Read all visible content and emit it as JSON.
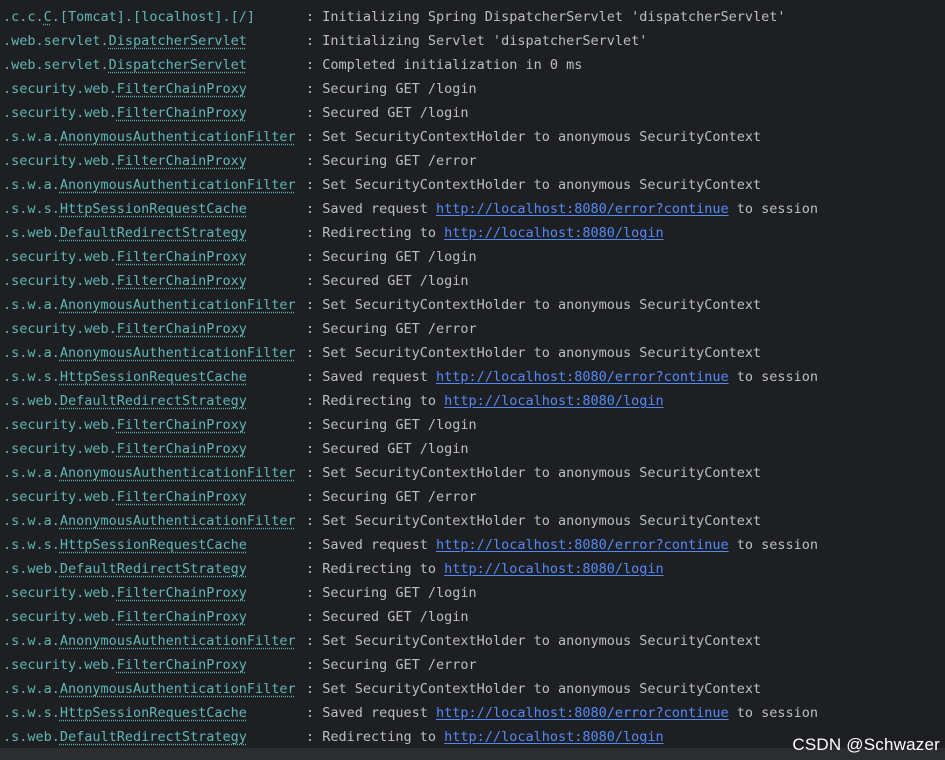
{
  "colors": {
    "background": "#1e1f22",
    "logger_text": "#5fb8b3",
    "message_text": "#bcbec4",
    "link": "#548af7",
    "watermark": "#ffffff"
  },
  "console": {
    "lines": [
      {
        "logger_prefix": ".c.c.",
        "logger_class": "C",
        "logger_suffix": ".[Tomcat].[localhost].[/]",
        "msg_before": ": Initializing Spring DispatcherServlet 'dispatcherServlet'",
        "link": "",
        "msg_after": ""
      },
      {
        "logger_prefix": ".web.servlet.",
        "logger_class": "DispatcherServlet",
        "logger_suffix": "",
        "msg_before": ": Initializing Servlet 'dispatcherServlet'",
        "link": "",
        "msg_after": ""
      },
      {
        "logger_prefix": ".web.servlet.",
        "logger_class": "DispatcherServlet",
        "logger_suffix": "",
        "msg_before": ": Completed initialization in 0 ms",
        "link": "",
        "msg_after": ""
      },
      {
        "logger_prefix": ".security.web.",
        "logger_class": "FilterChainProxy",
        "logger_suffix": "",
        "msg_before": ": Securing GET /login",
        "link": "",
        "msg_after": ""
      },
      {
        "logger_prefix": ".security.web.",
        "logger_class": "FilterChainProxy",
        "logger_suffix": "",
        "msg_before": ": Secured GET /login",
        "link": "",
        "msg_after": ""
      },
      {
        "logger_prefix": ".s.w.a.",
        "logger_class": "AnonymousAuthenticationFilter",
        "logger_suffix": "",
        "msg_before": ": Set SecurityContextHolder to anonymous SecurityContext",
        "link": "",
        "msg_after": ""
      },
      {
        "logger_prefix": ".security.web.",
        "logger_class": "FilterChainProxy",
        "logger_suffix": "",
        "msg_before": ": Securing GET /error",
        "link": "",
        "msg_after": ""
      },
      {
        "logger_prefix": ".s.w.a.",
        "logger_class": "AnonymousAuthenticationFilter",
        "logger_suffix": "",
        "msg_before": ": Set SecurityContextHolder to anonymous SecurityContext",
        "link": "",
        "msg_after": ""
      },
      {
        "logger_prefix": ".s.w.s.",
        "logger_class": "HttpSessionRequestCache",
        "logger_suffix": "",
        "msg_before": ": Saved request ",
        "link": "http://localhost:8080/error?continue",
        "msg_after": " to session"
      },
      {
        "logger_prefix": ".s.web.",
        "logger_class": "DefaultRedirectStrategy",
        "logger_suffix": "",
        "msg_before": ": Redirecting to ",
        "link": "http://localhost:8080/login",
        "msg_after": ""
      },
      {
        "logger_prefix": ".security.web.",
        "logger_class": "FilterChainProxy",
        "logger_suffix": "",
        "msg_before": ": Securing GET /login",
        "link": "",
        "msg_after": ""
      },
      {
        "logger_prefix": ".security.web.",
        "logger_class": "FilterChainProxy",
        "logger_suffix": "",
        "msg_before": ": Secured GET /login",
        "link": "",
        "msg_after": ""
      },
      {
        "logger_prefix": ".s.w.a.",
        "logger_class": "AnonymousAuthenticationFilter",
        "logger_suffix": "",
        "msg_before": ": Set SecurityContextHolder to anonymous SecurityContext",
        "link": "",
        "msg_after": ""
      },
      {
        "logger_prefix": ".security.web.",
        "logger_class": "FilterChainProxy",
        "logger_suffix": "",
        "msg_before": ": Securing GET /error",
        "link": "",
        "msg_after": ""
      },
      {
        "logger_prefix": ".s.w.a.",
        "logger_class": "AnonymousAuthenticationFilter",
        "logger_suffix": "",
        "msg_before": ": Set SecurityContextHolder to anonymous SecurityContext",
        "link": "",
        "msg_after": ""
      },
      {
        "logger_prefix": ".s.w.s.",
        "logger_class": "HttpSessionRequestCache",
        "logger_suffix": "",
        "msg_before": ": Saved request ",
        "link": "http://localhost:8080/error?continue",
        "msg_after": " to session"
      },
      {
        "logger_prefix": ".s.web.",
        "logger_class": "DefaultRedirectStrategy",
        "logger_suffix": "",
        "msg_before": ": Redirecting to ",
        "link": "http://localhost:8080/login",
        "msg_after": ""
      },
      {
        "logger_prefix": ".security.web.",
        "logger_class": "FilterChainProxy",
        "logger_suffix": "",
        "msg_before": ": Securing GET /login",
        "link": "",
        "msg_after": ""
      },
      {
        "logger_prefix": ".security.web.",
        "logger_class": "FilterChainProxy",
        "logger_suffix": "",
        "msg_before": ": Secured GET /login",
        "link": "",
        "msg_after": ""
      },
      {
        "logger_prefix": ".s.w.a.",
        "logger_class": "AnonymousAuthenticationFilter",
        "logger_suffix": "",
        "msg_before": ": Set SecurityContextHolder to anonymous SecurityContext",
        "link": "",
        "msg_after": ""
      },
      {
        "logger_prefix": ".security.web.",
        "logger_class": "FilterChainProxy",
        "logger_suffix": "",
        "msg_before": ": Securing GET /error",
        "link": "",
        "msg_after": ""
      },
      {
        "logger_prefix": ".s.w.a.",
        "logger_class": "AnonymousAuthenticationFilter",
        "logger_suffix": "",
        "msg_before": ": Set SecurityContextHolder to anonymous SecurityContext",
        "link": "",
        "msg_after": ""
      },
      {
        "logger_prefix": ".s.w.s.",
        "logger_class": "HttpSessionRequestCache",
        "logger_suffix": "",
        "msg_before": ": Saved request ",
        "link": "http://localhost:8080/error?continue",
        "msg_after": " to session"
      },
      {
        "logger_prefix": ".s.web.",
        "logger_class": "DefaultRedirectStrategy",
        "logger_suffix": "",
        "msg_before": ": Redirecting to ",
        "link": "http://localhost:8080/login",
        "msg_after": ""
      },
      {
        "logger_prefix": ".security.web.",
        "logger_class": "FilterChainProxy",
        "logger_suffix": "",
        "msg_before": ": Securing GET /login",
        "link": "",
        "msg_after": ""
      },
      {
        "logger_prefix": ".security.web.",
        "logger_class": "FilterChainProxy",
        "logger_suffix": "",
        "msg_before": ": Secured GET /login",
        "link": "",
        "msg_after": ""
      },
      {
        "logger_prefix": ".s.w.a.",
        "logger_class": "AnonymousAuthenticationFilter",
        "logger_suffix": "",
        "msg_before": ": Set SecurityContextHolder to anonymous SecurityContext",
        "link": "",
        "msg_after": ""
      },
      {
        "logger_prefix": ".security.web.",
        "logger_class": "FilterChainProxy",
        "logger_suffix": "",
        "msg_before": ": Securing GET /error",
        "link": "",
        "msg_after": ""
      },
      {
        "logger_prefix": ".s.w.a.",
        "logger_class": "AnonymousAuthenticationFilter",
        "logger_suffix": "",
        "msg_before": ": Set SecurityContextHolder to anonymous SecurityContext",
        "link": "",
        "msg_after": ""
      },
      {
        "logger_prefix": ".s.w.s.",
        "logger_class": "HttpSessionRequestCache",
        "logger_suffix": "",
        "msg_before": ": Saved request ",
        "link": "http://localhost:8080/error?continue",
        "msg_after": " to session"
      },
      {
        "logger_prefix": ".s.web.",
        "logger_class": "DefaultRedirectStrategy",
        "logger_suffix": "",
        "msg_before": ": Redirecting to ",
        "link": "http://localhost:8080/login",
        "msg_after": ""
      }
    ]
  },
  "watermark": {
    "text": "CSDN @Schwazer"
  }
}
